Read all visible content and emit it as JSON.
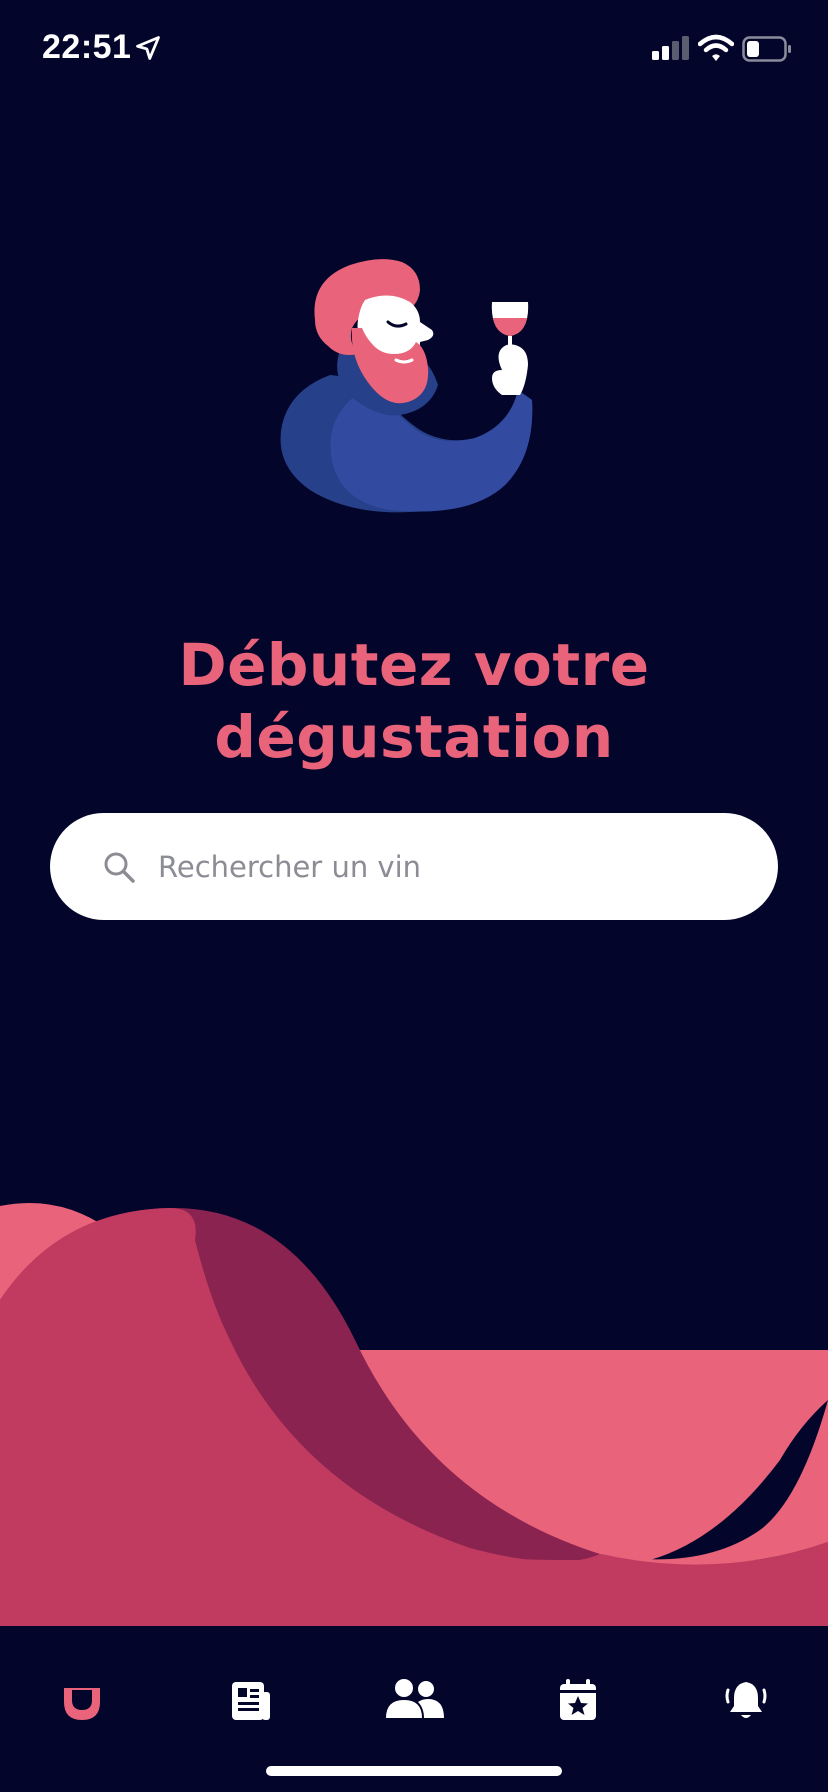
{
  "status_bar": {
    "time": "22:51"
  },
  "main": {
    "title_line1": "Débutez votre",
    "title_line2": "dégustation"
  },
  "search": {
    "placeholder": "Rechercher un vin",
    "value": ""
  },
  "tab_bar": {
    "tabs": [
      {
        "icon": "glass-logo-icon",
        "active": true
      },
      {
        "icon": "newspaper-icon",
        "active": false
      },
      {
        "icon": "users-icon",
        "active": false
      },
      {
        "icon": "calendar-star-icon",
        "active": false
      },
      {
        "icon": "bell-icon",
        "active": false
      }
    ]
  },
  "colors": {
    "background": "#03052b",
    "accent": "#e9637a",
    "wave_light": "#e9637a",
    "wave_mid": "#c13b60",
    "wave_dark": "#8a2350",
    "sweater": "#324ba0",
    "sweater_shadow": "#27408a"
  }
}
